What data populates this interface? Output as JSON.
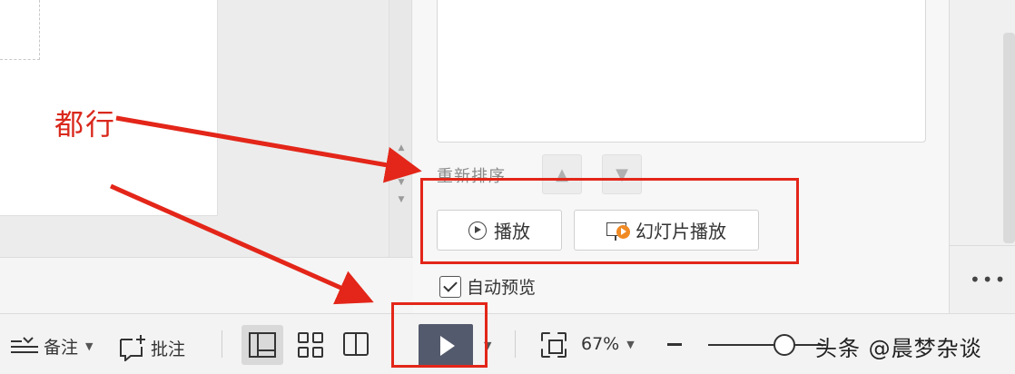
{
  "task_pane": {
    "reorder_label": "重新排序",
    "play_label": "播放",
    "slideshow_label": "幻灯片播放",
    "auto_preview_label": "自动预览",
    "auto_preview_checked": true,
    "more_label": "•••"
  },
  "status_bar": {
    "notes_label": "备注",
    "comments_label": "批注",
    "zoom_value": "67%",
    "zoom_level": 0.67
  },
  "annotation": {
    "label": "都行",
    "color": "#e32619"
  },
  "watermark": {
    "text": "头条 @晨梦杂谈"
  },
  "colors": {
    "play_slideshow_button": "#545a6d",
    "slideshow_icon_accent": "#f08a24"
  },
  "icons": {
    "up": "arrow-up-icon",
    "down": "arrow-down-icon",
    "play": "play-circle-icon",
    "slideshow": "slideshow-icon",
    "notes": "notes-icon",
    "comments": "add-comment-icon",
    "normal_view": "normal-view-icon",
    "sorter_view": "slide-sorter-icon",
    "reading_view": "reading-view-icon",
    "fit": "fit-to-window-icon"
  }
}
